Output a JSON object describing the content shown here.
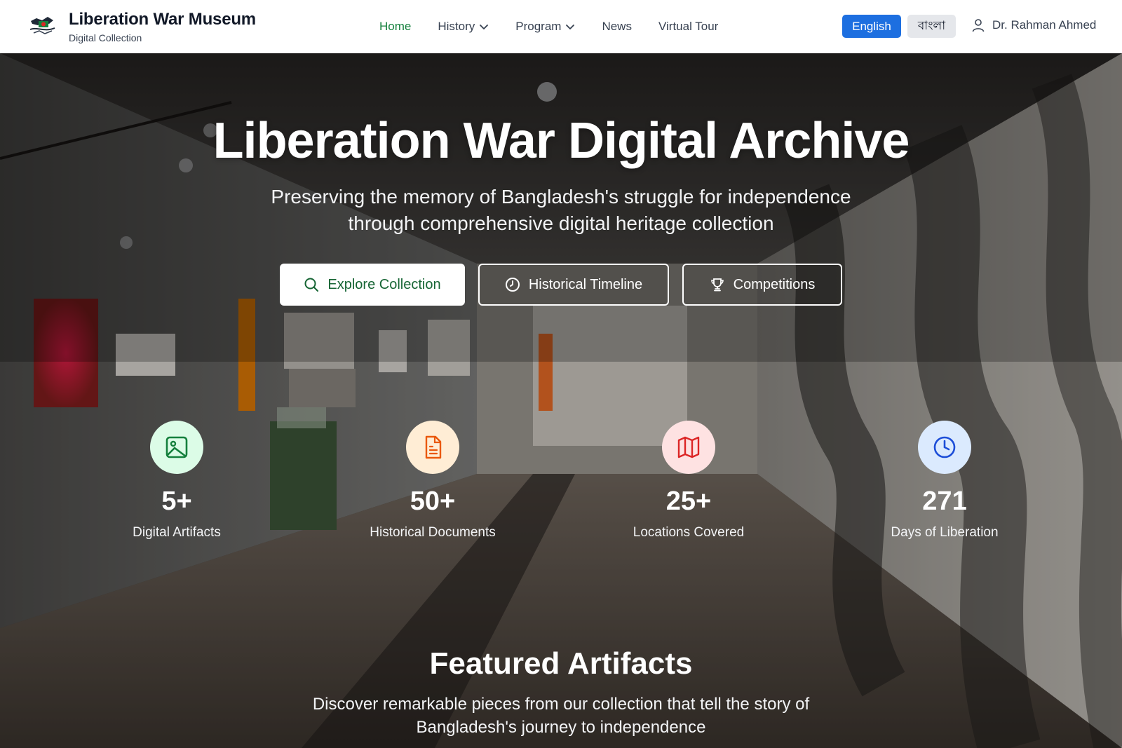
{
  "header": {
    "brand_title": "Liberation War Museum",
    "brand_subtitle": "Digital Collection",
    "nav": [
      {
        "label": "Home",
        "active": true,
        "dropdown": false
      },
      {
        "label": "History",
        "active": false,
        "dropdown": true
      },
      {
        "label": "Program",
        "active": false,
        "dropdown": true
      },
      {
        "label": "News",
        "active": false,
        "dropdown": false
      },
      {
        "label": "Virtual Tour",
        "active": false,
        "dropdown": false
      }
    ],
    "lang_english": "English",
    "lang_bangla": "বাংলা",
    "user_name": "Dr. Rahman Ahmed"
  },
  "hero": {
    "title": "Liberation War Digital Archive",
    "subtitle": "Preserving the memory of Bangladesh's struggle for independence through comprehensive digital heritage collection",
    "buttons": {
      "explore": "Explore Collection",
      "timeline": "Historical Timeline",
      "competitions": "Competitions"
    }
  },
  "stats": [
    {
      "value": "5+",
      "label": "Digital Artifacts",
      "icon": "image-icon",
      "color": "#15803d",
      "bg": "#dcfce7"
    },
    {
      "value": "50+",
      "label": "Historical Documents",
      "icon": "document-icon",
      "color": "#ea580c",
      "bg": "#ffedd5"
    },
    {
      "value": "25+",
      "label": "Locations Covered",
      "icon": "map-icon",
      "color": "#dc2626",
      "bg": "#fee2e2"
    },
    {
      "value": "271",
      "label": "Days of Liberation",
      "icon": "clock-icon",
      "color": "#1d4ed8",
      "bg": "#dbeafe"
    }
  ],
  "featured": {
    "title": "Featured Artifacts",
    "subtitle": "Discover remarkable pieces from our collection that tell the story of Bangladesh's journey to independence"
  },
  "colors": {
    "accent_green": "#15803d",
    "accent_blue": "#1d6fe0"
  }
}
